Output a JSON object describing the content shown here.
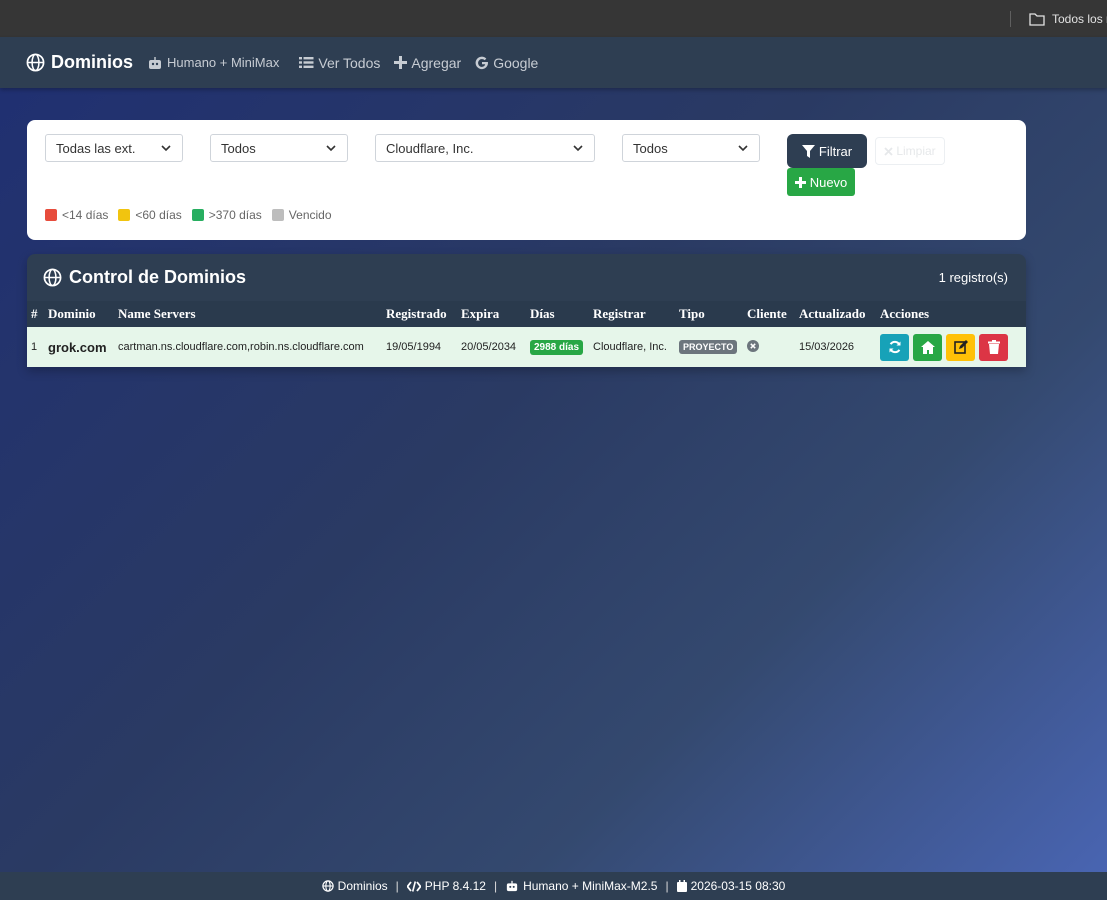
{
  "browser": {
    "bookmark_label": "Todos los marcadores"
  },
  "navbar": {
    "brand": "Dominios",
    "agent": "Humano + MiniMax",
    "links": {
      "ver_todos": "Ver Todos",
      "agregar": "Agregar",
      "google": "Google"
    }
  },
  "filters": {
    "ext_value": "Todas las ext.",
    "status_value": "Todos",
    "registrar_value": "Cloudflare, Inc.",
    "type_value": "Todos",
    "filter_label": "Filtrar",
    "clear_label": "Limpiar",
    "new_label": "Nuevo"
  },
  "legend": [
    {
      "label": "<14 días",
      "color": "#e74c3c"
    },
    {
      "label": "<60 días",
      "color": "#f1c40f"
    },
    {
      "label": ">370 días",
      "color": "#27ae60"
    },
    {
      "label": "Vencido",
      "color": "#bdbdbd"
    }
  ],
  "table": {
    "title": "Control de Dominios",
    "count": "1 registro(s)",
    "headers": [
      "#",
      "Dominio",
      "Name Servers",
      "Registrado",
      "Expira",
      "Días",
      "Registrar",
      "Tipo",
      "Cliente",
      "Actualizado",
      "Acciones"
    ],
    "rows": [
      {
        "num": "1",
        "domain": "grok.com",
        "ns": "cartman.ns.cloudflare.com,robin.ns.cloudflare.com",
        "registered": "19/05/1994",
        "expires": "20/05/2034",
        "days": "2988 días",
        "registrar": "Cloudflare, Inc.",
        "type": "PROYECTO",
        "updated": "15/03/2026"
      }
    ]
  },
  "actions_colors": {
    "refresh": "#17a2b8",
    "home": "#28a745",
    "edit": "#ffc107",
    "delete": "#dc3545"
  },
  "footer": {
    "brand": "Dominios",
    "php": "PHP 8.4.12",
    "agent": "Humano + MiniMax-M2.5",
    "date": "2026-03-15 08:30"
  }
}
